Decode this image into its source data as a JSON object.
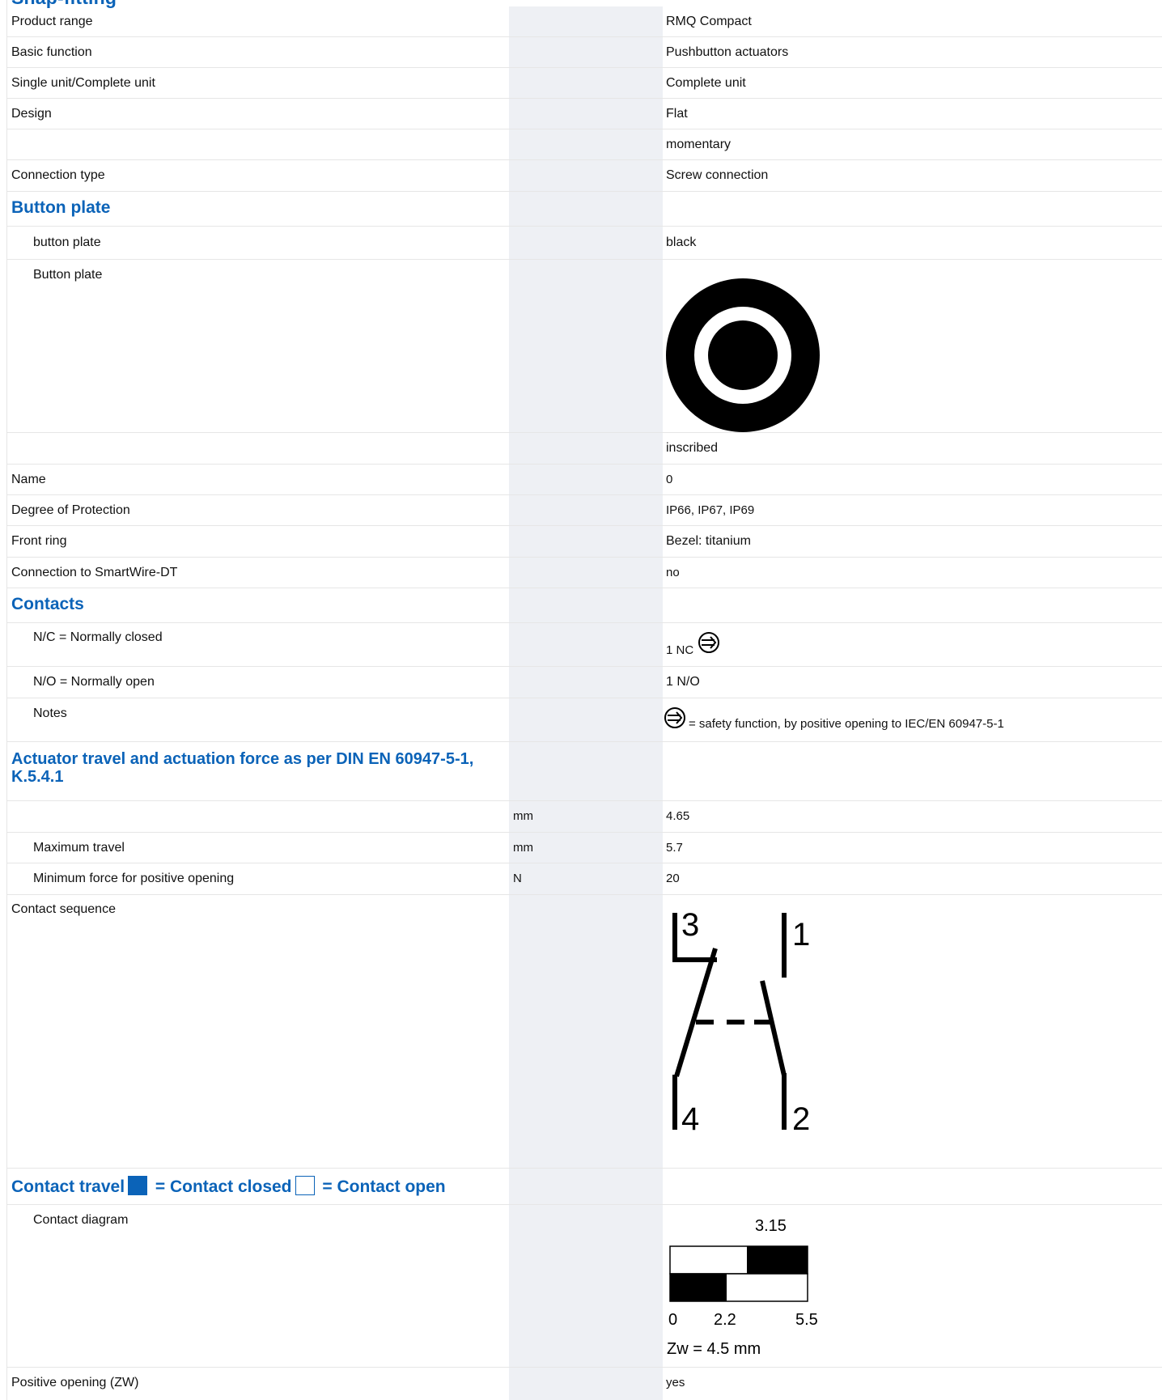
{
  "section_top_partial": "Snap-fitting",
  "rows": {
    "product_range": {
      "label": "Product range",
      "value": "RMQ Compact"
    },
    "basic_function": {
      "label": "Basic function",
      "value": "Pushbutton actuators"
    },
    "single_complete": {
      "label": "Single unit/Complete unit",
      "value": "Complete unit"
    },
    "design": {
      "label": "Design",
      "value": "Flat"
    },
    "momentary": {
      "label": "",
      "value": "momentary"
    },
    "connection_type": {
      "label": "Connection type",
      "value": "Screw connection"
    },
    "button_plate_header": {
      "label": "Button plate"
    },
    "button_plate_color": {
      "label": "button plate",
      "value": "black"
    },
    "button_plate_img": {
      "label": "Button plate"
    },
    "inscribed": {
      "label": "",
      "value": "inscribed"
    },
    "name": {
      "label": "Name",
      "value": "0"
    },
    "degree_protection": {
      "label": "Degree of Protection",
      "value": "IP66, IP67, IP69"
    },
    "front_ring": {
      "label": "Front ring",
      "value": "Bezel: titanium"
    },
    "smartwire": {
      "label": "Connection to SmartWire-DT",
      "value": "no"
    },
    "contacts_header": {
      "label": "Contacts"
    },
    "nc": {
      "label": "N/C = Normally closed",
      "value": "1 NC"
    },
    "no": {
      "label": "N/O = Normally open",
      "value": "1 N/O"
    },
    "notes": {
      "label": "Notes",
      "value": "= safety function, by positive opening to IEC/EN 60947-5-1"
    },
    "actuator_header": {
      "label": "Actuator travel and actuation force as per DIN EN 60947-5-1, K.5.4.1"
    },
    "travel_blank": {
      "label": "",
      "unit": "mm",
      "value": "4.65"
    },
    "max_travel": {
      "label": "Maximum travel",
      "unit": "mm",
      "value": "5.7"
    },
    "min_force": {
      "label": "Minimum force for positive opening",
      "unit": "N",
      "value": "20"
    },
    "contact_sequence": {
      "label": "Contact sequence"
    },
    "contact_travel_header": {
      "label_a": "Contact travel",
      "label_b": " = Contact closed",
      "label_c": " = Contact open"
    },
    "contact_diagram": {
      "label": "Contact diagram"
    },
    "positive_opening": {
      "label": "Positive opening (ZW)",
      "value": "yes"
    }
  },
  "contact_sequence_symbol": {
    "terminals": [
      "3",
      "1",
      "4",
      "2"
    ]
  },
  "contact_diagram_figure": {
    "top_label": "3.15",
    "axis_labels": [
      "0",
      "2.2",
      "5.5"
    ],
    "zw": "Zw = 4.5 mm"
  },
  "colors": {
    "accent": "#0b63b8",
    "unit_band": "#eef0f4",
    "rule": "#e6e6e6"
  },
  "icons": {
    "positive_opening": "positive-opening-icon",
    "button_plate": "button-plate-icon"
  }
}
